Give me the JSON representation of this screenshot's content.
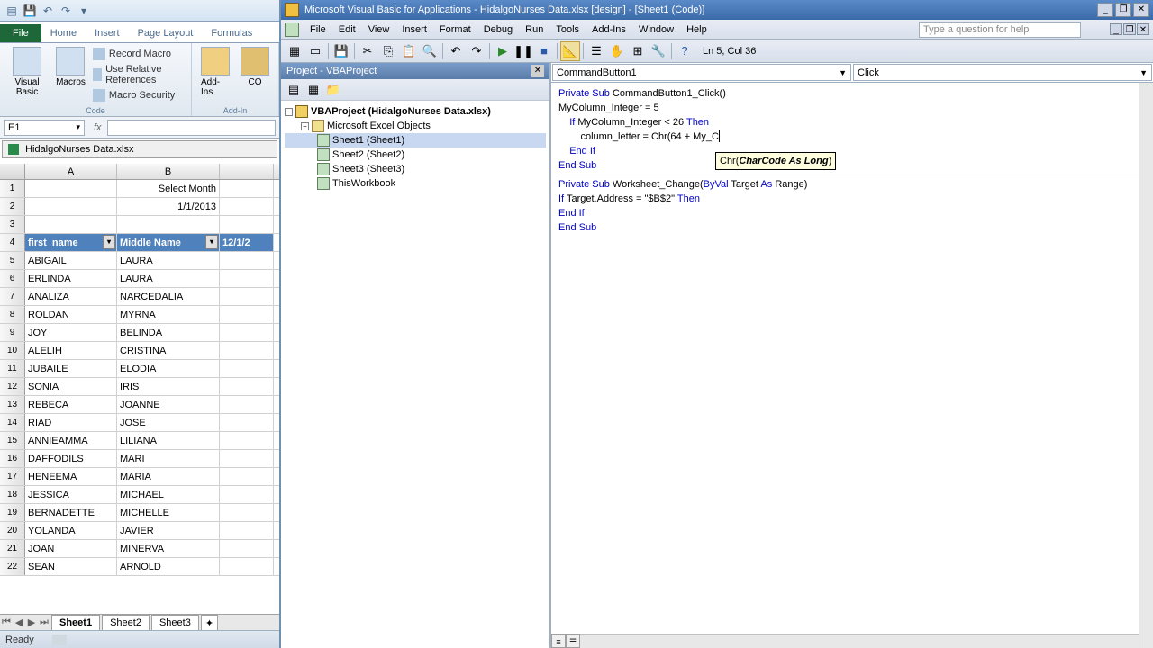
{
  "excel": {
    "qat_icons": [
      "▤",
      "💾",
      "↶",
      "↷",
      "▾"
    ],
    "tabs": {
      "file": "File",
      "items": [
        "Home",
        "Insert",
        "Page Layout",
        "Formulas"
      ]
    },
    "ribbon": {
      "visual_basic": "Visual Basic",
      "macros": "Macros",
      "record_macro": "Record Macro",
      "use_relative": "Use Relative References",
      "macro_security": "Macro Security",
      "code_label": "Code",
      "addins": "Add-Ins",
      "com_addins": "CO",
      "addins_label": "Add-In"
    },
    "name_box": "E1",
    "formula_fx": "fx",
    "workbook": "HidalgoNurses Data.xlsx",
    "columns": [
      "A",
      "B"
    ],
    "rows": [
      {
        "n": "1",
        "a": "",
        "b": "Select Month"
      },
      {
        "n": "2",
        "a": "",
        "b": "1/1/2013"
      },
      {
        "n": "3",
        "a": "",
        "b": ""
      },
      {
        "n": "4",
        "a": "first_name",
        "b": "Middle Name",
        "c": "12/1/2",
        "header": true
      },
      {
        "n": "5",
        "a": "ABIGAIL",
        "b": "LAURA"
      },
      {
        "n": "6",
        "a": "ERLINDA",
        "b": "LAURA"
      },
      {
        "n": "7",
        "a": "ANALIZA",
        "b": "NARCEDALIA"
      },
      {
        "n": "8",
        "a": "ROLDAN",
        "b": "MYRNA"
      },
      {
        "n": "9",
        "a": "JOY",
        "b": "BELINDA"
      },
      {
        "n": "10",
        "a": "ALELIH",
        "b": "CRISTINA"
      },
      {
        "n": "11",
        "a": "JUBAILE",
        "b": "ELODIA"
      },
      {
        "n": "12",
        "a": "SONIA",
        "b": "IRIS"
      },
      {
        "n": "13",
        "a": "REBECA",
        "b": "JOANNE"
      },
      {
        "n": "14",
        "a": "RIAD",
        "b": "JOSE"
      },
      {
        "n": "15",
        "a": "ANNIEAMMA",
        "b": "LILIANA"
      },
      {
        "n": "16",
        "a": "DAFFODILS",
        "b": "MARI"
      },
      {
        "n": "17",
        "a": "HENEEMA",
        "b": "MARIA"
      },
      {
        "n": "18",
        "a": "JESSICA",
        "b": "MICHAEL"
      },
      {
        "n": "19",
        "a": "BERNADETTE",
        "b": "MICHELLE"
      },
      {
        "n": "20",
        "a": "YOLANDA",
        "b": "JAVIER"
      },
      {
        "n": "21",
        "a": "JOAN",
        "b": "MINERVA"
      },
      {
        "n": "22",
        "a": "SEAN",
        "b": "ARNOLD"
      }
    ],
    "sheet_tabs": [
      "Sheet1",
      "Sheet2",
      "Sheet3"
    ],
    "status": "Ready"
  },
  "vba": {
    "title": "Microsoft Visual Basic for Applications - HidalgoNurses Data.xlsx [design] - [Sheet1 (Code)]",
    "menu": [
      "File",
      "Edit",
      "View",
      "Insert",
      "Format",
      "Debug",
      "Run",
      "Tools",
      "Add-Ins",
      "Window",
      "Help"
    ],
    "help_placeholder": "Type a question for help",
    "cursor_pos": "Ln 5, Col 36",
    "project_title": "Project - VBAProject",
    "tree": {
      "root": "VBAProject (HidalgoNurses Data.xlsx)",
      "folder": "Microsoft Excel Objects",
      "items": [
        "Sheet1 (Sheet1)",
        "Sheet2 (Sheet2)",
        "Sheet3 (Sheet3)",
        "ThisWorkbook"
      ]
    },
    "object_dd": "CommandButton1",
    "proc_dd": "Click",
    "code": {
      "l1a": "Private Sub",
      "l1b": " CommandButton1_Click()",
      "l2": "MyColumn_Integer = 5",
      "l3": "",
      "l4a": "    If ",
      "l4b": "MyColumn_Integer < 26 ",
      "l4c": "Then",
      "l5": "        column_letter = Chr(64 + My_C",
      "l6a": "    End If",
      "l7": "",
      "l8": "",
      "l9": "End Sub",
      "l10": "",
      "l11a": "Private Sub",
      "l11b": " Worksheet_Change(",
      "l11c": "ByVal",
      "l11d": " Target ",
      "l11e": "As",
      "l11f": " Range)",
      "l12a": "If ",
      "l12b": "Target.Address = \"$B$2\" ",
      "l12c": "Then",
      "l13": "",
      "l14": "End If",
      "l15": "End Sub"
    },
    "tooltip_plain": "Chr(",
    "tooltip_bold": "CharCode As Long",
    "tooltip_close": ")"
  }
}
